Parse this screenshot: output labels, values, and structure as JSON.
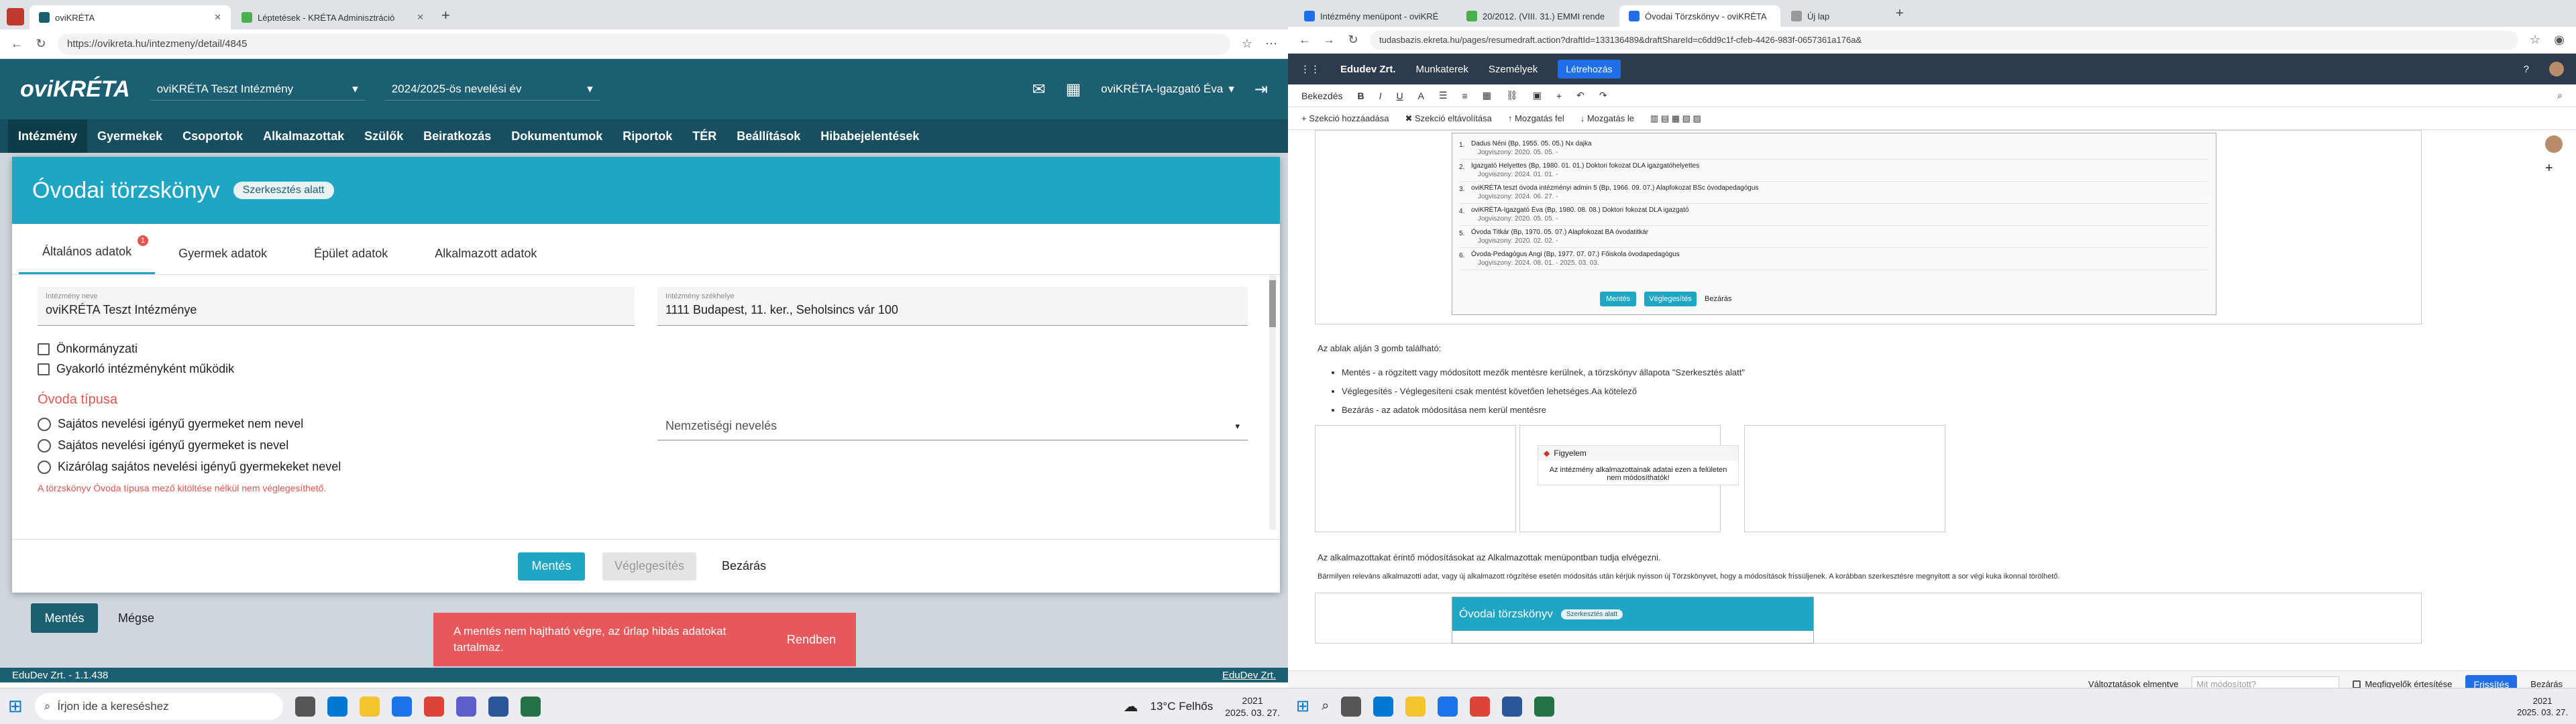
{
  "left": {
    "tabs": [
      {
        "label": "oviKRÉTA",
        "color": "#1c5f72"
      },
      {
        "label": "Léptetések - KRÉTA Adminisztráció",
        "color": "#4caf50"
      }
    ],
    "url": "https://ovikreta.hu/intezmeny/detail/4845",
    "header": {
      "logo": "oviKRÉTA",
      "institution": "oviKRÉTA Teszt Intézmény",
      "year": "2024/2025-ös nevelési év",
      "user": "oviKRÉTA-Igazgató Éva"
    },
    "nav": [
      "Intézmény",
      "Gyermekek",
      "Csoportok",
      "Alkalmazottak",
      "Szülők",
      "Beiratkozás",
      "Dokumentumok",
      "Riportok",
      "TÉR",
      "Beállítások",
      "Hibabejelentések"
    ],
    "modal": {
      "title": "Óvodai törzskönyv",
      "status": "Szerkesztés alatt",
      "tabs": [
        "Általános adatok",
        "Gyermek adatok",
        "Épület adatok",
        "Alkalmazott adatok"
      ],
      "tab_badge": "1",
      "name_label": "Intézmény neve",
      "name_value": "oviKRÉTA Teszt Intézménye",
      "seat_label": "Intézmény székhelye",
      "seat_value": "1111 Budapest, 11. ker., Seholsincs vár 100",
      "check1": "Önkormányzati",
      "check2": "Gyakorló intézményként működik",
      "section": "Óvoda típusa",
      "radio1": "Sajátos nevelési igényű gyermeket nem nevel",
      "radio2": "Sajátos nevelési igényű gyermeket is nevel",
      "radio3": "Kizárólag sajátos nevelési igényű gyermekeket nevel",
      "error": "A törzskönyv Óvoda típusa mező kitöltése nélkül nem véglegesíthető.",
      "nationality_placeholder": "Nemzetiségi nevelés",
      "save": "Mentés",
      "finalize": "Véglegesítés",
      "close": "Bezárás"
    },
    "under": {
      "save": "Mentés",
      "cancel": "Mégse"
    },
    "toast": {
      "text": "A mentés nem hajtható végre, az űrlap hibás adatokat tartalmaz.",
      "ok": "Rendben"
    },
    "footer": {
      "left": "EduDev Zrt. - 1.1.438",
      "right": "EduDev Zrt."
    },
    "taskbar": {
      "search": "Írjon ide a kereséshez",
      "weather": "13°C Felhős",
      "time": "2021",
      "date": "2025. 03. 27."
    }
  },
  "right": {
    "tabs": [
      "Intézmény menüpont - oviKRÉ",
      "20/2012. (VIII. 31.) EMMI rende",
      "Óvodai Törzskönyv - oviKRÉTA",
      "Új lap"
    ],
    "url": "tudasbazis.ekreta.hu/pages/resumedraft.action?draftId=133136489&draftShareId=c6dd9c1f-cfeb-4426-983f-0657361a176a&",
    "top": {
      "brand": "Edudev Zrt.",
      "menu1": "Munkaterek",
      "menu2": "Személyek",
      "create": "Létrehozás"
    },
    "toolbar": {
      "style": "Bekezdés"
    },
    "toolbar2": [
      "Szekció hozzáadása",
      "Szekció eltávolítása",
      "Mozgatás fel",
      "Mozgatás le"
    ],
    "staff": [
      {
        "line": "Dadus Néni (Bp, 1955. 05. 05.)   Nx   dajka",
        "sub": "Jogviszony: 2020. 05. 05. -"
      },
      {
        "line": "Igazgató Helyettes (Bp, 1980. 01. 01.)   Doktori fokozat DLA   igazgatóhelyettes",
        "sub": "Jogviszony: 2024. 01. 01. -"
      },
      {
        "line": "oviKRÉTA teszt óvoda intézményi admin 5 (Bp, 1966. 09. 07.)   Alapfokozat BSc   óvodapedagógus",
        "sub": "Jogviszony: 2024. 06. 27. -"
      },
      {
        "line": "oviKRÉTA-Igazgató Éva (Bp, 1980. 08. 08.)   Doktori fokozat DLA   igazgató",
        "sub": "Jogviszony: 2020. 05. 05. -"
      },
      {
        "line": "Óvoda Titkár (Bp, 1970. 05. 07.)   Alapfokozat BA   óvodatitkár",
        "sub": "Jogviszony: 2020. 02. 02. -"
      },
      {
        "line": "Óvoda-Pedagógus Angi (Bp, 1977. 07. 07.)   Főiskola   óvodapedagógus",
        "sub": "Jogviszony: 2024. 08. 01. - 2025. 03. 03."
      }
    ],
    "panel_buttons": {
      "save": "Mentés",
      "finalize": "Véglegesítés",
      "close": "Bezárás"
    },
    "p_intro": "Az ablak alján 3 gomb található:",
    "bullets": [
      "Mentés - a rögzített vagy módosított mezők mentésre kerülnek, a törzskönyv állapota \"Szerkesztés alatt\"",
      "Véglegesítés - Véglegesíteni csak mentést követően lehetséges.Aa kötelező",
      "Bezárás - az adatok módosítása nem kerül mentésre"
    ],
    "warn_title": "Figyelem",
    "warn_text": "Az intézmény alkalmazottainak adatai ezen a felületen nem módosíthatók!",
    "p2": "Az alkalmazottakat érintő módosításokat az Alkalmazottak menüpontban tudja elvégezni.",
    "p3": "Bármilyen releváns alkalmazotti adat, vagy új alkalmazott rögzítése esetén módosítás után kérjük nyisson új Törzskönyvet, hogy a módosítások frissüljenek. A korábban szerkesztésre megnyitott a sor végi kuka ikonnal törölhető.",
    "preview_title": "Óvodai törzskönyv",
    "preview_badge": "Szerkesztés alatt",
    "footer": {
      "changes": "Változtatások elmentve",
      "what": "Mit módosított?",
      "notify": "Megfigyelők értesítése",
      "publish": "Frissítés",
      "close": "Bezárás"
    },
    "taskbar": {
      "time": "2021",
      "date": "2025. 03. 27."
    }
  }
}
